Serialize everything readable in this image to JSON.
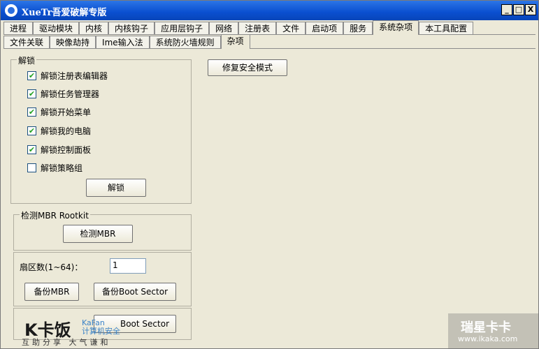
{
  "window": {
    "title": "XueTr吾爱破解专版",
    "btn_min": "_",
    "btn_max": "□",
    "btn_close": "X"
  },
  "tabs_main": [
    "进程",
    "驱动模块",
    "内核",
    "内核钩子",
    "应用层钩子",
    "网络",
    "注册表",
    "文件",
    "启动项",
    "服务",
    "系统杂项",
    "本工具配置"
  ],
  "tabs_main_active": "系统杂项",
  "tabs_sub": [
    "文件关联",
    "映像劫持",
    "Ime输入法",
    "系统防火墙规则",
    "杂项"
  ],
  "tabs_sub_active": "杂项",
  "unlock": {
    "legend": "解锁",
    "items": [
      {
        "label": "解锁注册表编辑器",
        "checked": true
      },
      {
        "label": "解锁任务管理器",
        "checked": true
      },
      {
        "label": "解锁开始菜单",
        "checked": true
      },
      {
        "label": "解锁我的电脑",
        "checked": true
      },
      {
        "label": "解锁控制面板",
        "checked": true
      },
      {
        "label": "解锁策略组",
        "checked": false
      }
    ],
    "button": "解锁",
    "check_mark": "✔"
  },
  "repair_safe_mode": "修复安全模式",
  "mbr": {
    "legend": "检测MBR Rootkit",
    "detect_button": "检测MBR",
    "sector_label": "扇区数(1~64)：",
    "sector_value": "1",
    "backup_mbr": "备份MBR",
    "backup_boot": "备份Boot Sector",
    "restore_boot": "Boot Sector"
  },
  "watermark": {
    "logo": "K卡饭",
    "logo_en": "KaFan",
    "logo_cn": "计算机安全",
    "slogan": "互助分享  大气谦和",
    "site_name": "瑞星卡卡",
    "site_url": "www.ikaka.com"
  }
}
